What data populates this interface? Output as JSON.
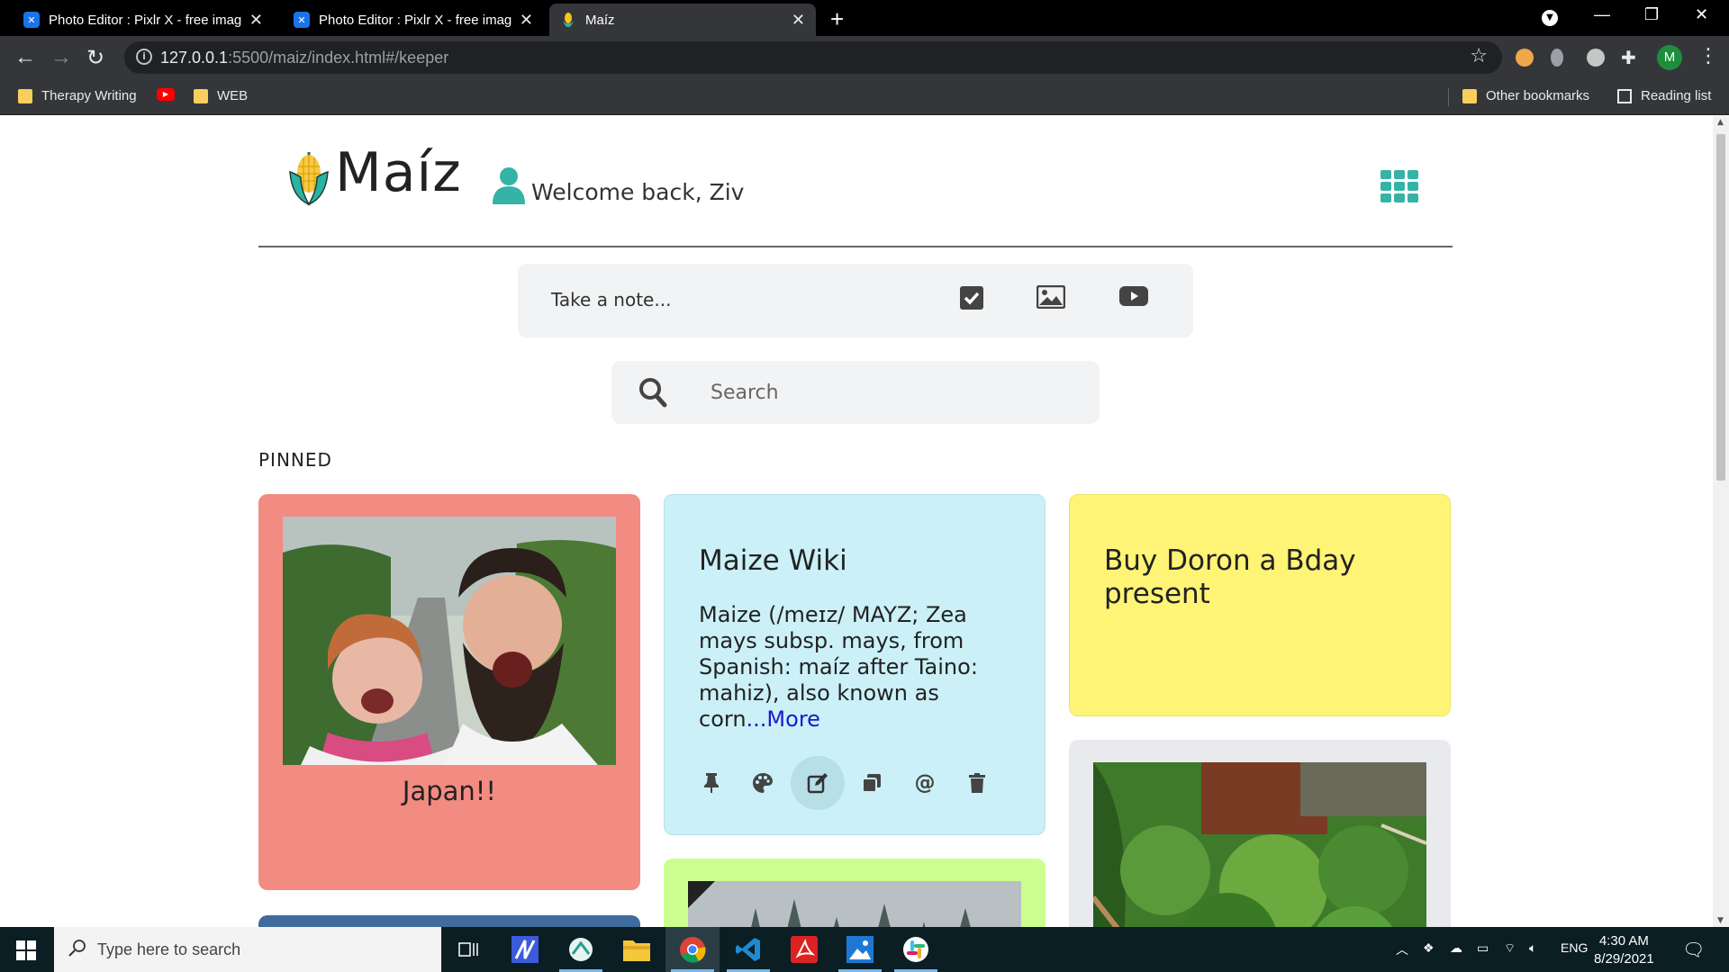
{
  "browser": {
    "tabs": [
      {
        "title": "Photo Editor : Pixlr X - free image"
      },
      {
        "title": "Photo Editor : Pixlr X - free image"
      },
      {
        "title": "Maíz"
      }
    ],
    "url_host": "127.0.0.1",
    "url_path": ":5500/maiz/index.html#/keeper",
    "profile_initial": "M",
    "bookmarks": [
      {
        "label": "Therapy Writing"
      },
      {
        "label": "WEB"
      }
    ],
    "other_bookmarks": "Other bookmarks",
    "reading_list": "Reading list"
  },
  "app": {
    "logo_text": "Maíz",
    "welcome": "Welcome back, Ziv",
    "note_placeholder": "Take a note...",
    "search_placeholder": "Search",
    "pinned_label": "PINNED",
    "accent_color": "#35b3a6"
  },
  "notes": {
    "japan": {
      "caption": "Japan!!",
      "color": "#f28b82"
    },
    "maize": {
      "title": "Maize Wiki",
      "body": "Maize (/meɪz/ MAYZ; Zea mays subsp. mays, from Spanish: maíz after Taino: mahiz), also known as corn",
      "more": "...More",
      "color": "#cbf0f8"
    },
    "doron": {
      "title": "Buy Doron a Bday present",
      "color": "#fff475"
    }
  },
  "taskbar": {
    "search_placeholder": "Type here to search",
    "lang": "ENG",
    "time": "4:30 AM",
    "date": "8/29/2021"
  }
}
